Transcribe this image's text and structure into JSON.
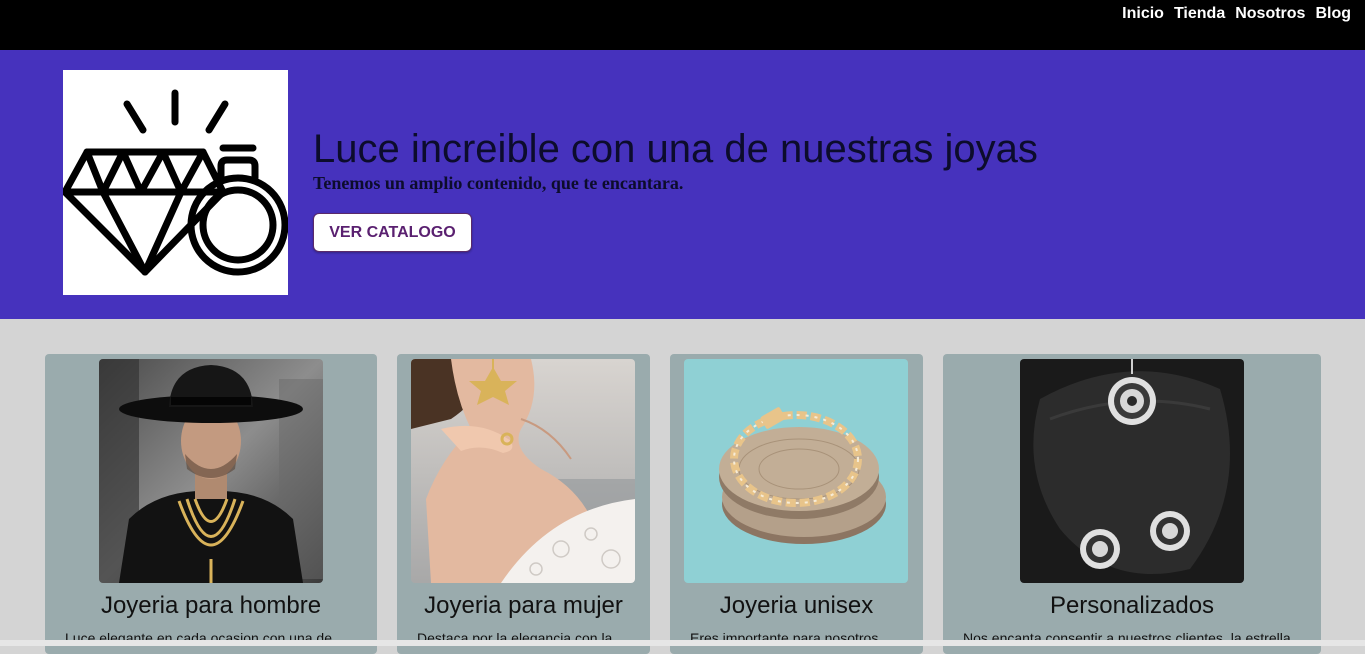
{
  "nav": {
    "items": [
      {
        "label": "Inicio"
      },
      {
        "label": "Tienda"
      },
      {
        "label": "Nosotros"
      },
      {
        "label": "Blog"
      }
    ]
  },
  "hero": {
    "logo_icon": "diamond-ring-icon",
    "title": "Luce increible con una de nuestras joyas",
    "subtitle": "Tenemos un amplio contenido, que te encantara.",
    "button_label": "VER CATALOGO"
  },
  "cards": [
    {
      "title": "Joyeria para hombre",
      "text": "Luce elegante en cada ocasion con una de"
    },
    {
      "title": "Joyeria para mujer",
      "text": "Destaca por la elegancia con la"
    },
    {
      "title": "Joyeria unisex",
      "text": "Eres importante para nosotros,"
    },
    {
      "title": "Personalizados",
      "text": "Nos encanta consentir a nuestros clientes, la estrella"
    }
  ],
  "colors": {
    "nav_bg": "#000000",
    "hero_bg": "#4632bd",
    "card_bg": "#9aabad",
    "page_bg": "#d4d4d4"
  }
}
